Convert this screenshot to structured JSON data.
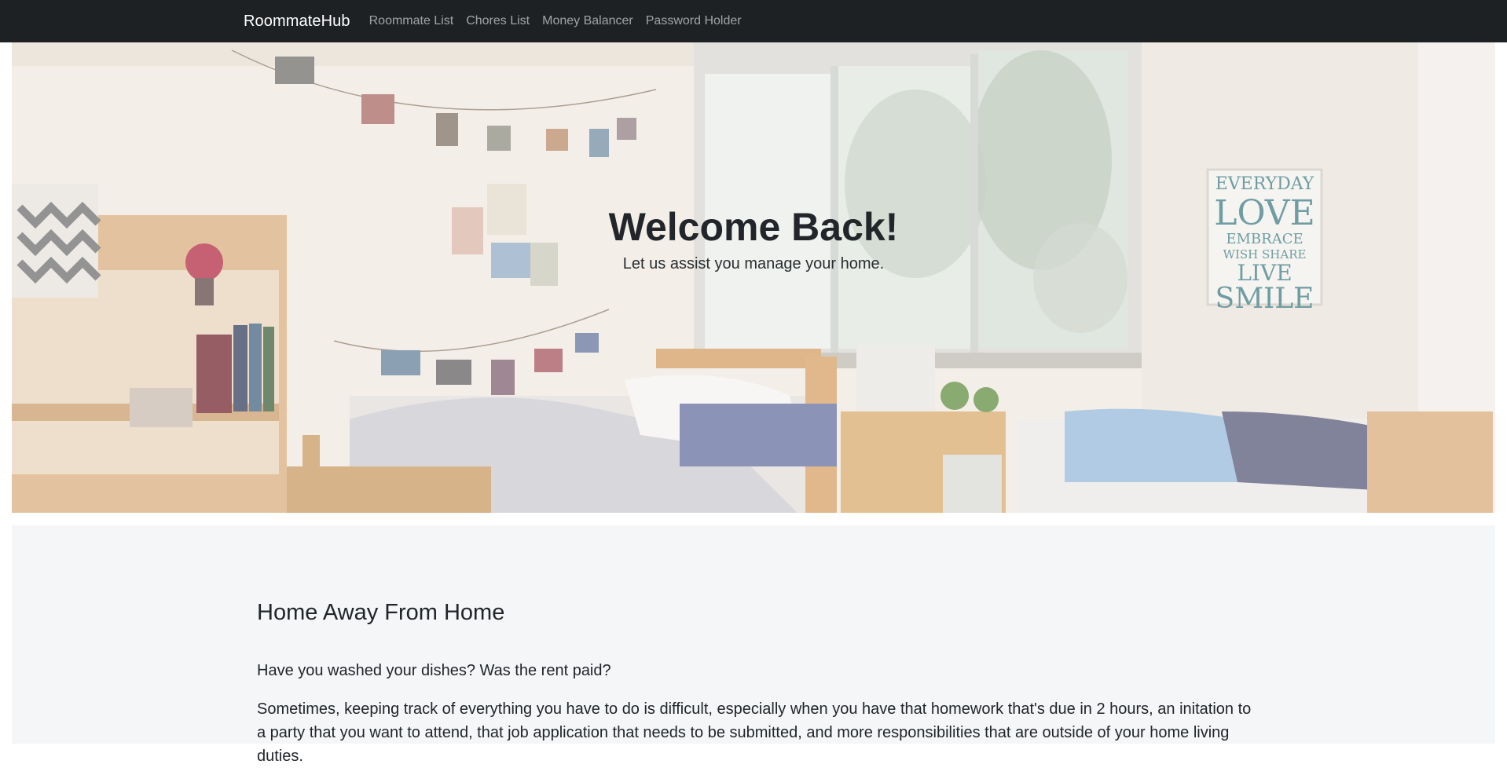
{
  "navbar": {
    "brand": "RoommateHub",
    "links": [
      "Roommate List",
      "Chores List",
      "Money Balancer",
      "Password Holder"
    ]
  },
  "hero": {
    "title": "Welcome Back!",
    "subtitle": "Let us assist you manage your home.",
    "poster_lines": [
      "EVERYDAY",
      "LOVE",
      "EMBRACE",
      "WISH SHARE",
      "LIVE",
      "SMILE"
    ]
  },
  "section": {
    "heading": "Home Away From Home",
    "question": "Have you washed your dishes? Was the rent paid?",
    "paragraph": "Sometimes, keeping track of everything you have to do is difficult, especially when you have that homework that's due in 2 hours, an initation to a party that you want to attend, that job application that needs to be submitted, and more responsibilities that are outside of your home living duties."
  },
  "colors": {
    "navbar_bg": "#1e2124",
    "brand": "#ffffff",
    "nav_link": "#9a9c9e",
    "content_bg": "#f5f6f8"
  }
}
